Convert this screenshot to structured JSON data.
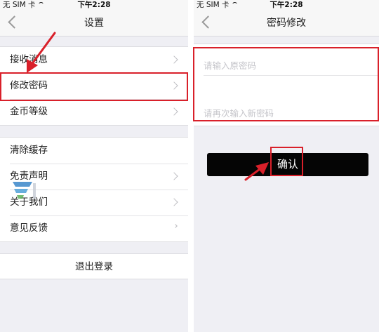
{
  "status_bar": {
    "carrier": "无 SIM 卡",
    "time": "下午2:28"
  },
  "left_screen": {
    "title": "设置",
    "group1": [
      {
        "label": "接收消息"
      },
      {
        "label": "修改密码"
      },
      {
        "label": "金币等级"
      }
    ],
    "group2": [
      {
        "label": "清除缓存"
      },
      {
        "label": "免责声明"
      },
      {
        "label": "关于我们"
      },
      {
        "label": "意见反馈"
      }
    ],
    "logout_label": "退出登录"
  },
  "right_screen": {
    "title": "密码修改",
    "old_password_placeholder": "请输入原密码",
    "new_password_placeholder": "请再次输入新密码",
    "confirm_label": "确认"
  },
  "colors": {
    "highlight": "#d9202a",
    "confirm_button": "#050505",
    "background": "#efeff4"
  },
  "icons": [
    "back-chevron-icon",
    "chevron-right-icon",
    "wifi-icon",
    "annotation-arrow-icon",
    "watermark-logo-icon"
  ]
}
